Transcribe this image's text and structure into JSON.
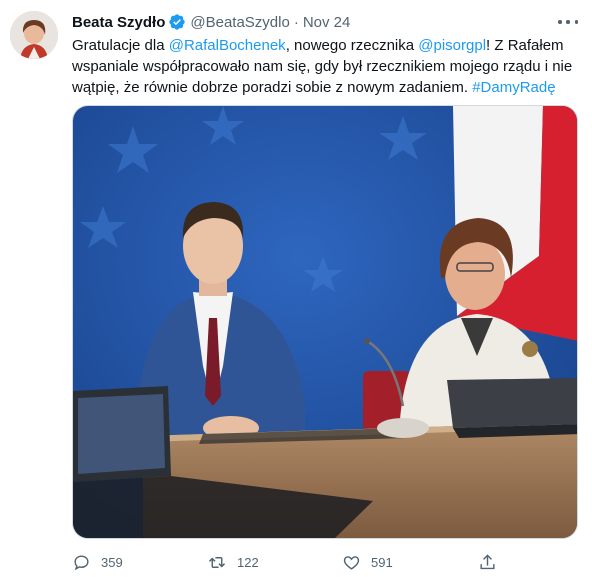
{
  "author": {
    "display_name": "Beata Szydło",
    "handle": "@BeataSzydlo",
    "separator": "·",
    "time": "Nov 24"
  },
  "tweet": {
    "line1": {
      "t1": "Gratulacje dla ",
      "mention1": "@RafalBochenek",
      "t2": ", nowego rzecznika ",
      "mention2": "@pisorgpl",
      "t3": "! Z Rafałem"
    },
    "line2": "wspaniale współpracowało nam się, gdy był rzecznikiem mojego rządu i nie",
    "line3": {
      "t1": "wątpię, że równie dobrze poradzi sobie z nowym zadaniem. ",
      "hashtag": "#DamyRadę"
    }
  },
  "actions": {
    "reply": {
      "icon": "reply-icon",
      "count": "359"
    },
    "retweet": {
      "icon": "retweet-icon",
      "count": "122"
    },
    "like": {
      "icon": "heart-icon",
      "count": "591"
    },
    "share": {
      "icon": "share-icon"
    }
  },
  "colors": {
    "link": "#1d9bf0",
    "verified": "#1d9bf0",
    "muted": "#536471",
    "eu_blue": "#1f4fa0"
  }
}
